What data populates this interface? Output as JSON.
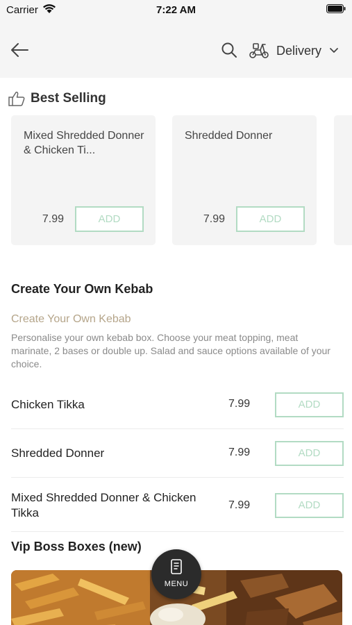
{
  "status_bar": {
    "carrier": "Carrier",
    "time": "7:22 AM"
  },
  "header": {
    "order_mode": "Delivery",
    "icons": [
      "back-arrow-icon",
      "search-icon",
      "scooter-icon",
      "chevron-down-icon"
    ]
  },
  "best_selling": {
    "title": "Best Selling",
    "icon": "thumbs-up-icon",
    "items": [
      {
        "name": "Mixed Shredded Donner & Chicken Ti...",
        "price": "7.99",
        "add_label": "ADD"
      },
      {
        "name": "Shredded Donner",
        "price": "7.99",
        "add_label": "ADD"
      }
    ]
  },
  "create_section": {
    "title": "Create Your Own Kebab",
    "subtitle": "Create Your Own Kebab",
    "description": "Personalise your own kebab box. Choose your meat topping, meat marinate, 2 bases or double up. Salad and sauce options available of your choice.",
    "items": [
      {
        "name": "Chicken Tikka",
        "price": "7.99",
        "add_label": "ADD"
      },
      {
        "name": "Shredded Donner",
        "price": "7.99",
        "add_label": "ADD"
      },
      {
        "name": "Mixed Shredded Donner & Chicken Tikka",
        "price": "7.99",
        "add_label": "ADD"
      }
    ]
  },
  "vip_section": {
    "title": "Vip Boss Boxes (new)"
  },
  "menu_button": {
    "label": "MENU"
  },
  "colors": {
    "accent_green": "#b2dbc3",
    "subtitle_tan": "#b5a58a",
    "header_bg": "#f5f5f5"
  }
}
